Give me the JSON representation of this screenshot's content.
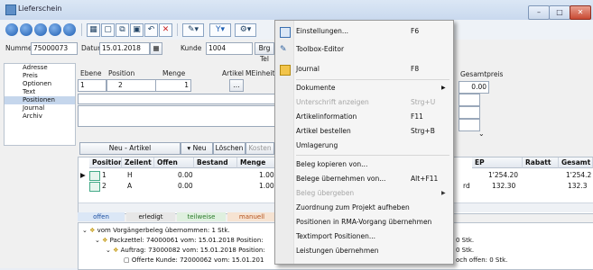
{
  "window": {
    "title": "Lieferschein",
    "min_label": "–",
    "max_label": "□",
    "close_label": "✕"
  },
  "header": {
    "nummer_label": "Nummer",
    "nummer_value": "75000073",
    "datum_label": "Datum",
    "datum_value": "15.01.2018",
    "kunde_label": "Kunde",
    "kunde_value": "1004",
    "brg_label": "Brg",
    "tel_label": "Tel"
  },
  "sidebar": {
    "items": [
      "Adresse",
      "Preis",
      "Optionen",
      "Text",
      "Positionen",
      "Journal",
      "Archiv"
    ],
    "selected": "Positionen"
  },
  "pos_panel": {
    "ebene_label": "Ebene",
    "position_label": "Position",
    "menge_label": "Menge",
    "artikel_label": "Artikel",
    "mbnheit_label": "MEinheit",
    "ebene_value": "1",
    "position_value": "2",
    "menge_value": "1",
    "artikel_btn": "...",
    "gesamtpreis_label": "Gesamtpreis",
    "gesamtpreis_value": "0.00",
    "neu_artikel": "Neu - Artikel",
    "neu": "▾ Neu",
    "loeschen": "Löschen",
    "kosten": "Kosten"
  },
  "grid": {
    "headers": [
      "Position",
      "Zeilent",
      "Offen",
      "Bestand",
      "Menge"
    ],
    "right_headers": [
      "EP",
      "Rabatt",
      "Gesamt"
    ],
    "rows": [
      {
        "position": "1",
        "zeilent": "H",
        "offen": "0.00",
        "menge": "1.00",
        "ep": "1'254.20",
        "gesamt": "1'254.2"
      },
      {
        "position": "2",
        "zeilent": "A",
        "offen": "0.00",
        "menge": "1.00",
        "ep_prefix": "rd",
        "ep": "132.30",
        "gesamt": "132.3"
      }
    ]
  },
  "status_tabs": {
    "offen": "offen",
    "erledigt": "erledigt",
    "teilweise": "teilweise",
    "manuell": "manuell"
  },
  "tree": {
    "line1": "vom Vorgängerbeleg übernommen: 1 Stk.",
    "line2": "Packzettel: 74000061 vom: 15.01.2018 Position:",
    "line3": "Auftrag: 73000082 vom: 15.01.2018 Position:",
    "line4": "Offerte Kunde: 72000062 vom: 15.01.201",
    "right1": "0 Stk.",
    "right2": "0 Stk.",
    "right3": "och offen: 0 Stk."
  },
  "menu": {
    "items": [
      {
        "label": "Einstellungen...",
        "shortcut": "F6",
        "icon": "settings-icon",
        "enabled": true
      },
      {
        "label": "Toolbox-Editor",
        "shortcut": "",
        "icon": "wrench-icon",
        "enabled": true
      },
      {
        "label": "Journal",
        "shortcut": "F8",
        "icon": "journal-icon",
        "enabled": true
      },
      {
        "label": "Dokumente",
        "shortcut": "",
        "submenu": true,
        "enabled": true
      },
      {
        "label": "Unterschrift anzeigen",
        "shortcut": "Strg+U",
        "enabled": false
      },
      {
        "label": "Artikelinformation",
        "shortcut": "F11",
        "enabled": true
      },
      {
        "label": "Artikel bestellen",
        "shortcut": "Strg+B",
        "enabled": true
      },
      {
        "label": "Umlagerung",
        "shortcut": "",
        "enabled": true
      },
      {
        "label": "Beleg kopieren von...",
        "shortcut": "",
        "enabled": true
      },
      {
        "label": "Belege übernehmen von...",
        "shortcut": "Alt+F11",
        "enabled": true
      },
      {
        "label": "Beleg übergeben",
        "shortcut": "",
        "submenu": true,
        "enabled": false
      },
      {
        "label": "Zuordnung zum Projekt aufheben",
        "shortcut": "",
        "enabled": true
      },
      {
        "label": "Positionen in RMA-Vorgang übernehmen",
        "shortcut": "",
        "enabled": true
      },
      {
        "label": "Textimport Positionen...",
        "shortcut": "",
        "enabled": true
      },
      {
        "label": "Leistungen übernehmen",
        "shortcut": "",
        "enabled": true
      }
    ]
  }
}
